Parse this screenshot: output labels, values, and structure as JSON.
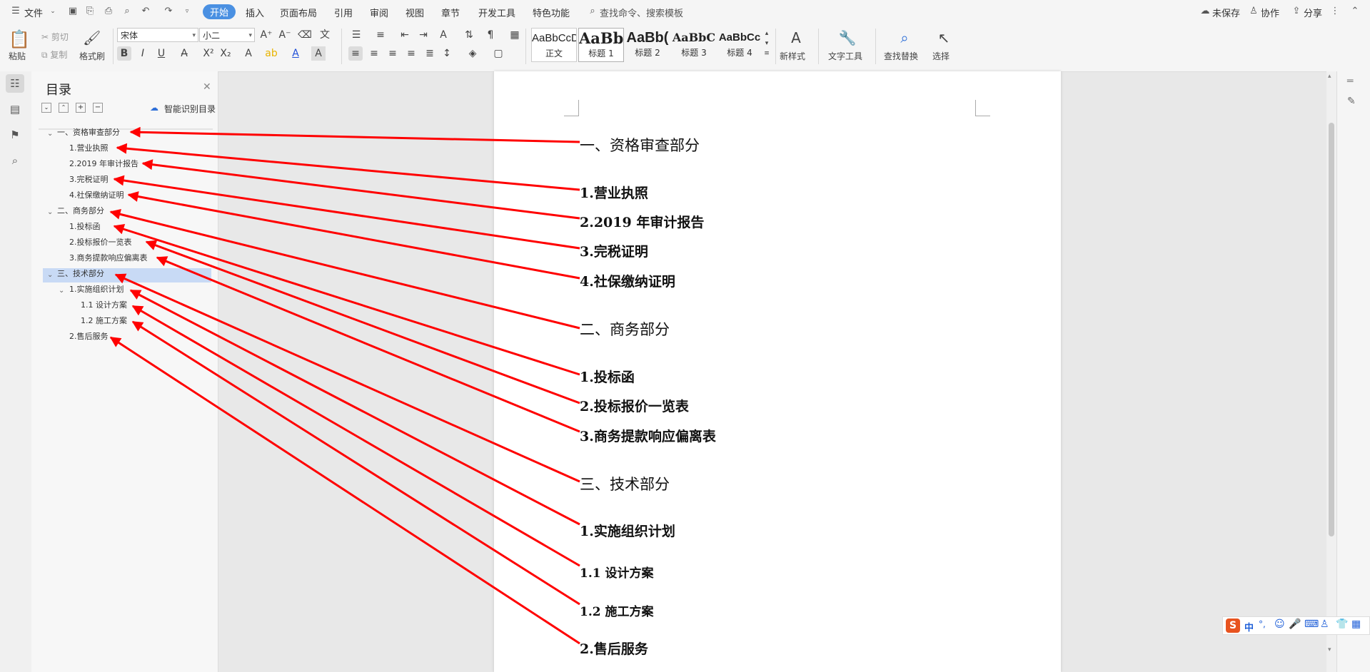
{
  "menu": {
    "file": "文件",
    "tabs": [
      "开始",
      "插入",
      "页面布局",
      "引用",
      "审阅",
      "视图",
      "章节",
      "开发工具",
      "特色功能"
    ],
    "search": "查找命令、搜索模板",
    "unsaved": "未保存",
    "collab": "协作",
    "share": "分享"
  },
  "ribbon": {
    "paste": "粘贴",
    "cut": "剪切",
    "copy": "复制",
    "format_painter": "格式刷",
    "font_name": "宋体",
    "font_size": "小二",
    "styles": [
      {
        "preview": "AaBbCcDd",
        "label": "正文"
      },
      {
        "preview": "AaBb(",
        "label": "标题 1"
      },
      {
        "preview": "AaBb(",
        "label": "标题 2"
      },
      {
        "preview": "AaBbC",
        "label": "标题 3"
      },
      {
        "preview": "AaBbCc",
        "label": "标题 4"
      }
    ],
    "new_style": "新样式",
    "text_tools": "文字工具",
    "find_replace": "查找替换",
    "select": "选择"
  },
  "toc_panel": {
    "title": "目录",
    "smart": "智能识别目录",
    "items": [
      "一、资格审查部分",
      "1.营业执照",
      "2.2019 年审计报告",
      "3.完税证明",
      "4.社保缴纳证明",
      "二、商务部分",
      "1.投标函",
      "2.投标报价一览表",
      "3.商务提款响应偏离表",
      "三、技术部分",
      "1.实施组织计划",
      "1.1 设计方案",
      "1.2 施工方案",
      "2.售后服务"
    ]
  },
  "document": {
    "headings": [
      "一、资格审查部分",
      "1.营业执照",
      "2.2019 年审计报告",
      "3.完税证明",
      "4.社保缴纳证明",
      "二、商务部分",
      "1.投标函",
      "2.投标报价一览表",
      "3.商务提款响应偏离表",
      "三、技术部分",
      "1.实施组织计划",
      "1.1 设计方案",
      "1.2 施工方案",
      "2.售后服务"
    ]
  },
  "ime": {
    "label": "中"
  },
  "colors": {
    "accent": "#4a90e2",
    "arrow": "#ff0000",
    "toc_selected": "#c8daf5"
  }
}
